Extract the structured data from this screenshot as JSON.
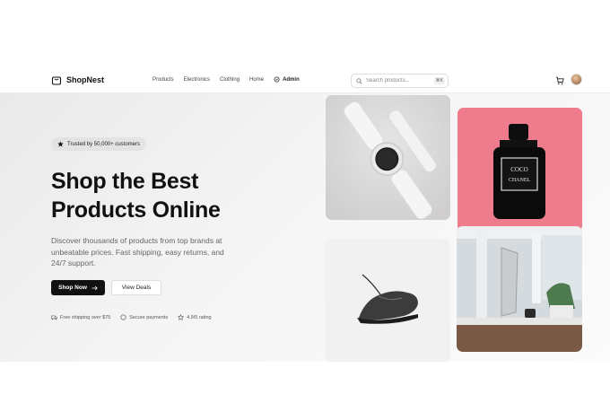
{
  "brand": {
    "name": "ShopNest"
  },
  "nav": {
    "links": [
      "Products",
      "Electronics",
      "Clothing",
      "Home"
    ],
    "admin_label": "Admin"
  },
  "search": {
    "placeholder": "Search products...",
    "shortcut": "⌘K"
  },
  "hero": {
    "badge": "Trusted by 50,000+ customers",
    "title_line1": "Shop the Best",
    "title_line2": "Products Online",
    "description": "Discover thousands of products from top brands at unbeatable prices. Fast shipping, easy returns, and 24/7 support.",
    "primary_cta": "Shop Now",
    "secondary_cta": "View Deals",
    "features": [
      "Free shipping over $75",
      "Secure payments",
      "4.9/5 rating"
    ]
  },
  "products": [
    {
      "icon": "smartwatch-image"
    },
    {
      "icon": "perfume-bottle-image",
      "label": "COCO CHANEL"
    },
    {
      "icon": "sneaker-image"
    },
    {
      "icon": "desk-setup-image"
    }
  ],
  "colors": {
    "primary": "#111111",
    "perfume_bg": "#ee7c8c",
    "page_bg": "#f4f4f4"
  }
}
